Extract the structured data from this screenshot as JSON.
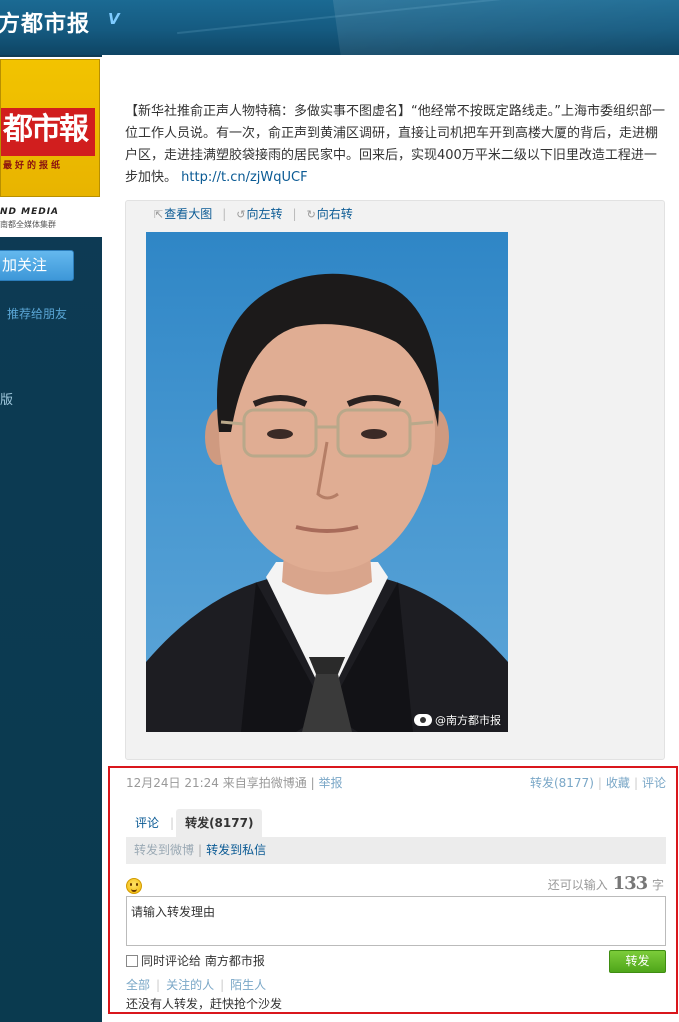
{
  "header": {
    "site_title": "方都市报",
    "verified_icon": "verified-v-icon"
  },
  "sidebar": {
    "logo": {
      "masthead": "都市報",
      "slogan": "最好的报纸",
      "media_en": "ND MEDIA",
      "group": "南都全媒体集群"
    },
    "follow_label": "加关注",
    "recommend_label": "推荐给朋友",
    "fragment_text": "版"
  },
  "post": {
    "text": "【新华社推俞正声人物特稿：多做实事不图虚名】“他经常不按既定路线走。”上海市委组织部一位工作人员说。有一次，俞正声到黄浦区调研，直接让司机把车开到高楼大厦的背后，走进棚户区，走进挂满塑胶袋接雨的居民家中。回来后，实现400万平米二级以下旧里改造工程进一步加快。",
    "link": "http://t.cn/zjWqUCF",
    "media_toolbar": {
      "view_large": "查看大图",
      "rotate_left": "向左转",
      "rotate_right": "向右转"
    },
    "watermark": "@南方都市报"
  },
  "repost": {
    "timestamp": "12月24日 21:24",
    "source": "来自享拍微博通",
    "report": "举报",
    "actions": {
      "forward": "转发(8177)",
      "favorite": "收藏",
      "comment": "评论"
    },
    "tabs": {
      "comment": "评论",
      "forward": "转发(8177)"
    },
    "subtabs": {
      "to_weibo": "转发到微博",
      "to_message": "转发到私信"
    },
    "counter": {
      "prefix": "还可以输入",
      "value": "133",
      "suffix": "字"
    },
    "input_placeholder": "请输入转发理由",
    "sync_comment_label": "同时评论给 南方都市报",
    "submit_label": "转发",
    "filters": {
      "all": "全部",
      "followed": "关注的人",
      "strangers": "陌生人"
    },
    "empty_note": "还没有人转发，赶快抢个沙发"
  },
  "colors": {
    "header_bg": "#155a80",
    "sidebar_bg": "#0c3a52",
    "link_blue": "#0a5a94",
    "highlight_border": "#d9171c",
    "submit_green": "#5fb526",
    "follow_blue": "#4ba4e1"
  }
}
